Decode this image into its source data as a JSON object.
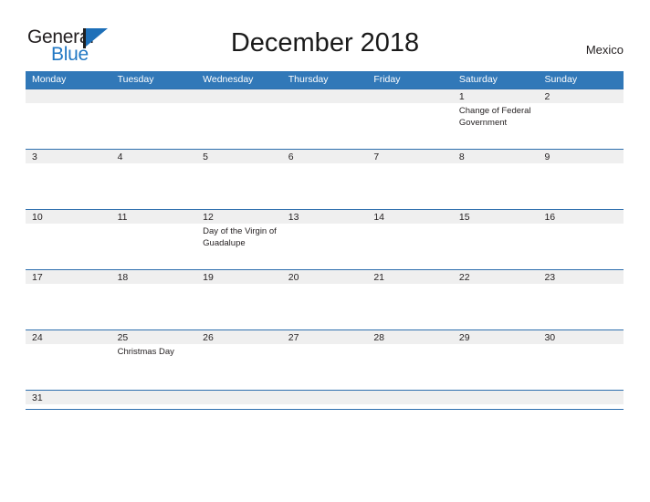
{
  "brand": {
    "name_part1": "General",
    "name_part2": "Blue",
    "mark_icon": "flag-triangle-icon"
  },
  "header": {
    "title": "December 2018",
    "country": "Mexico"
  },
  "calendar": {
    "weekdays": [
      "Monday",
      "Tuesday",
      "Wednesday",
      "Thursday",
      "Friday",
      "Saturday",
      "Sunday"
    ],
    "colors": {
      "header_blue": "#3178b8",
      "row_border_blue": "#2e6fae",
      "day_band_gray": "#efefef",
      "text": "#231f20",
      "logo_blue": "#2278c4"
    },
    "weeks": [
      [
        {
          "num": "",
          "event": ""
        },
        {
          "num": "",
          "event": ""
        },
        {
          "num": "",
          "event": ""
        },
        {
          "num": "",
          "event": ""
        },
        {
          "num": "",
          "event": ""
        },
        {
          "num": "1",
          "event": "Change of Federal Government"
        },
        {
          "num": "2",
          "event": ""
        }
      ],
      [
        {
          "num": "3",
          "event": ""
        },
        {
          "num": "4",
          "event": ""
        },
        {
          "num": "5",
          "event": ""
        },
        {
          "num": "6",
          "event": ""
        },
        {
          "num": "7",
          "event": ""
        },
        {
          "num": "8",
          "event": ""
        },
        {
          "num": "9",
          "event": ""
        }
      ],
      [
        {
          "num": "10",
          "event": ""
        },
        {
          "num": "11",
          "event": ""
        },
        {
          "num": "12",
          "event": "Day of the Virgin of Guadalupe"
        },
        {
          "num": "13",
          "event": ""
        },
        {
          "num": "14",
          "event": ""
        },
        {
          "num": "15",
          "event": ""
        },
        {
          "num": "16",
          "event": ""
        }
      ],
      [
        {
          "num": "17",
          "event": ""
        },
        {
          "num": "18",
          "event": ""
        },
        {
          "num": "19",
          "event": ""
        },
        {
          "num": "20",
          "event": ""
        },
        {
          "num": "21",
          "event": ""
        },
        {
          "num": "22",
          "event": ""
        },
        {
          "num": "23",
          "event": ""
        }
      ],
      [
        {
          "num": "24",
          "event": ""
        },
        {
          "num": "25",
          "event": "Christmas Day"
        },
        {
          "num": "26",
          "event": ""
        },
        {
          "num": "27",
          "event": ""
        },
        {
          "num": "28",
          "event": ""
        },
        {
          "num": "29",
          "event": ""
        },
        {
          "num": "30",
          "event": ""
        }
      ],
      [
        {
          "num": "31",
          "event": ""
        },
        {
          "num": "",
          "event": ""
        },
        {
          "num": "",
          "event": ""
        },
        {
          "num": "",
          "event": ""
        },
        {
          "num": "",
          "event": ""
        },
        {
          "num": "",
          "event": ""
        },
        {
          "num": "",
          "event": ""
        }
      ]
    ]
  }
}
